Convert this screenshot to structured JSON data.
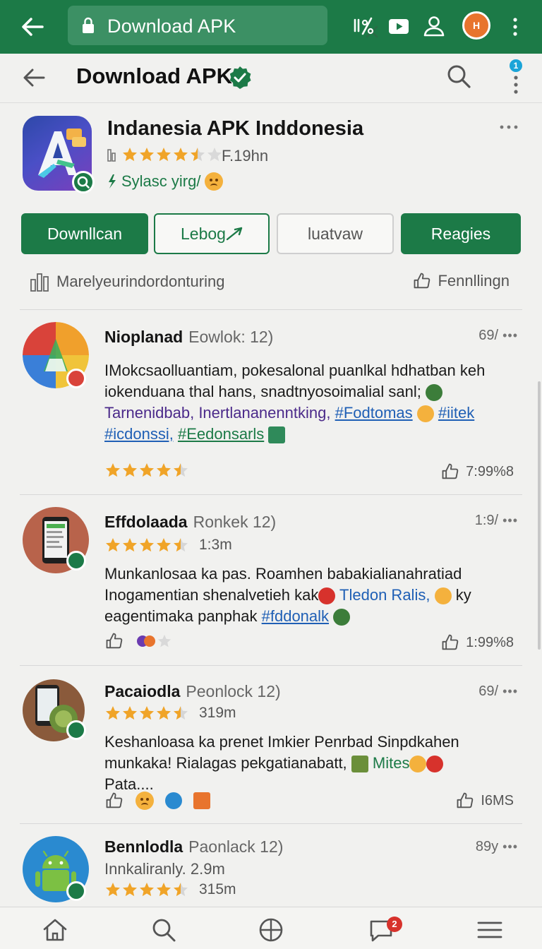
{
  "browser": {
    "url_text": "Download APK",
    "icons": [
      "back-arrow-icon",
      "lock-icon",
      "clear-icon",
      "tracking-off-icon",
      "youtube-icon",
      "profile-icon",
      "avatar",
      "more-vertical-icon"
    ],
    "avatar_initials": "H"
  },
  "header": {
    "title": "Download APK",
    "notification_count": "1"
  },
  "app": {
    "name": "Indanesia APK Inddonesia",
    "rating_stars": 4.5,
    "size": "F.19hn",
    "tagline": "Sylasc yirg/"
  },
  "actions": {
    "download": "Downllcan",
    "lebog": "Lebog",
    "iuatvaw": "luatvaw",
    "reagies": "Reagies"
  },
  "meta": {
    "left_text": "Marelyeurindordonturing",
    "right_text": "Fennllingn"
  },
  "reviews": [
    {
      "name": "Nioplanad",
      "sub": "Eowlok: 12)",
      "time": "69/",
      "text_line1": "IMokcsaolluantiam, pokesalonal puanlkal hdhatban keh",
      "text_line2": "iokenduana thal hans, snadtnyosoimalial sanl;",
      "text_line3_plain": "Tarnenidbab, Inertlananenntking,",
      "tag1": "#Fodtomas",
      "tag2": "#iitek",
      "tag3": "#icdonssi,",
      "tag4": "#Eedonsarls",
      "rating_stars": 4.5,
      "likes": "7:99%8"
    },
    {
      "name": "Effdolaada",
      "sub": "Ronkek 12)",
      "time": "1:9/",
      "duration": "1:3m",
      "rating_stars": 4.5,
      "text_line1": "Munkanlosaa ka pas. Roamhen babakialianahratiad",
      "text_line2": "Inogamentian shenalvetieh kak",
      "text_line2_link": "Tledon Ralis,",
      "text_line2_end": "ky",
      "text_line3": "eagentimaka panphak",
      "tag": "#fddonalk",
      "likes": "1:99%8"
    },
    {
      "name": "Pacaiodla",
      "sub": "Peonlock 12)",
      "time": "69/",
      "duration": "319m",
      "rating_stars": 4.5,
      "text_line1": "Keshanloasa ka prenet Imkier Penrbad Sinpdkahen",
      "text_line2": "munkaka! Rialagas pekgatianabatt,",
      "text_line2_green": "Mites",
      "text_line3": "Pata....",
      "likes": "I6MS"
    },
    {
      "name": "Bennlodla",
      "sub": "Paonlack 12)",
      "time": "89y",
      "text_line1": "Innkaliranly. 2.9m",
      "rating_stars": 4.5,
      "duration": "315m"
    }
  ],
  "bottom_nav": {
    "items": [
      "home-icon",
      "search-icon",
      "globe-icon",
      "chat-icon",
      "menu-icon"
    ],
    "chat_badge": "2"
  },
  "colors": {
    "brand_green": "#1c7a47",
    "star": "#f0a428",
    "link_blue": "#1f5fb5"
  }
}
